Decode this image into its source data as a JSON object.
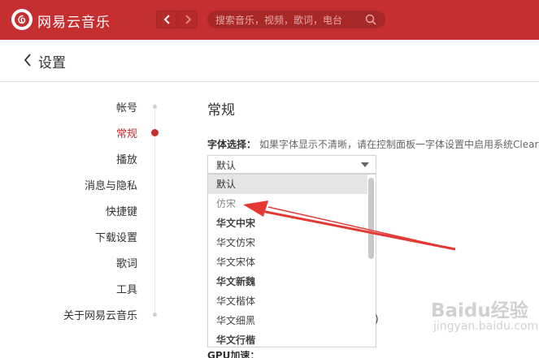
{
  "app": {
    "title": "网易云音乐",
    "accent_color": "#c62f2f",
    "logo_icon": "netease-logo-icon"
  },
  "toolbar": {
    "back_icon": "chevron-left-icon",
    "forward_icon": "chevron-right-icon",
    "search_placeholder": "搜索音乐，视频，歌词，电台",
    "search_icon": "search-icon"
  },
  "header": {
    "title": "设置",
    "back_icon": "chevron-left-icon"
  },
  "sidebar": {
    "items": [
      {
        "label": "帐号",
        "active": false
      },
      {
        "label": "常规",
        "active": true
      },
      {
        "label": "播放",
        "active": false
      },
      {
        "label": "消息与隐私",
        "active": false
      },
      {
        "label": "快捷键",
        "active": false
      },
      {
        "label": "下载设置",
        "active": false
      },
      {
        "label": "歌词",
        "active": false
      },
      {
        "label": "工具",
        "active": false
      },
      {
        "label": "关于网易云音乐",
        "active": false
      }
    ]
  },
  "main": {
    "section_title": "常规",
    "font_setting": {
      "label": "字体选择：",
      "hint": "如果字体显示不清晰，请在控制面板一字体设置中启用系统Clear",
      "selected_value": "默认",
      "options": [
        "默认",
        "仿宋",
        "华文中宋",
        "华文仿宋",
        "华文宋体",
        "华文新魏",
        "华文楷体",
        "华文细黑",
        "华文行楷"
      ]
    },
    "partial_paren": ")",
    "gpu_label": "GPU加速："
  },
  "watermark": {
    "text": "Baidu经验",
    "sub": "jingyan.baidu.com"
  }
}
